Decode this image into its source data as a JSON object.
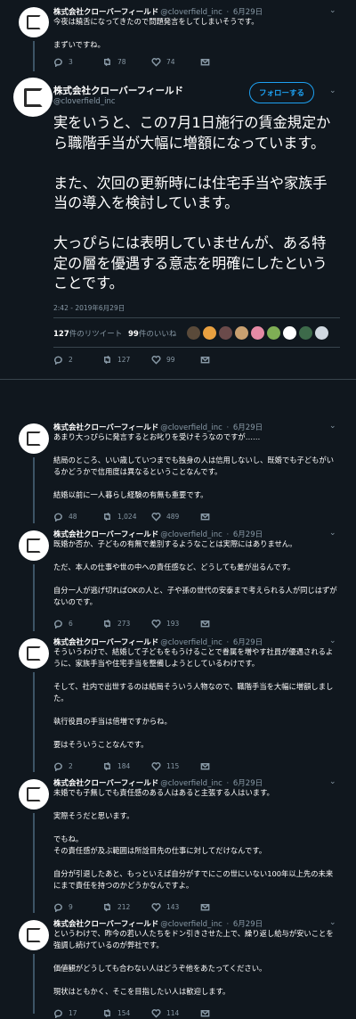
{
  "account": {
    "name": "株式会社クローバーフィールド",
    "handle": "@cloverfield_inc"
  },
  "tweet0": {
    "date": "6月29日",
    "lines": [
      "今夜は饒舌になってきたので問題発言をしてしまいそうです。",
      "まずいですね。"
    ],
    "replies": "3",
    "retweets": "78",
    "likes": "74"
  },
  "main": {
    "follow_label": "フォローする",
    "paragraphs": [
      "実をいうと、この7月1日施行の賃金規定から職階手当が大幅に増額になっています。",
      "また、次回の更新時には住宅手当や家族手当の導入を検討しています。",
      "大っぴらには表明していませんが、ある特定の層を優遇する意志を明確にしたということです。"
    ],
    "timestamp": "2:42 - 2019年6月29日",
    "retweet_count": "127",
    "retweet_label": "件のリツイート",
    "like_count": "99",
    "like_label": "件のいいね",
    "liker_colors": [
      "#5a4a3a",
      "#e8a040",
      "#6a4a4a",
      "#c9a070",
      "#e58aa5",
      "#7fae55",
      "#ffffff",
      "#3d6a4a",
      "#d0d8e0"
    ],
    "replies": "2",
    "retweets": "127",
    "likes": "99"
  },
  "tweets": [
    {
      "date": "6月29日",
      "lines": [
        "あまり大っぴらに発言するとお叱りを受けそうなのですが……",
        "結局のところ、いい歳していつまでも独身の人は信用しないし、既婚でも子どもがいるかどうかで信用度は異なるということなんです。",
        "結婚以前に一人暮らし経験の有無も重要です。"
      ],
      "replies": "48",
      "retweets": "1,024",
      "likes": "489"
    },
    {
      "date": "6月29日",
      "lines": [
        "既婚か否か、子どもの有無で差別するようなことは実際にはありません。",
        "ただ、本人の仕事や世の中への責任感など、どうしても差が出るんです。",
        "自分一人が逃げ切ればOKの人と、子や孫の世代の安泰まで考えられる人が同じはずがないのです。"
      ],
      "replies": "6",
      "retweets": "273",
      "likes": "193"
    },
    {
      "date": "6月29日",
      "lines": [
        "そういうわけで、結婚して子どもをもうけることで眷属を増やす社員が優遇されるように、家族手当や住宅手当を整備しようとしているわけです。",
        "そして、社内で出世するのは結局そういう人物なので、職階手当を大幅に増額しました。",
        "執行役員の手当は倍増ですからね。",
        "要はそういうことなんです。"
      ],
      "replies": "2",
      "retweets": "184",
      "likes": "115"
    },
    {
      "date": "6月29日",
      "lines": [
        "未婚でも子無しでも責任感のある人はあると主張する人はいます。",
        "実際そうだと思います。",
        "でもね。\nその責任感が及ぶ範囲は所詮目先の仕事に対してだけなんです。",
        "自分が引退したあと、もっといえば自分がすでにこの世にいない100年以上先の未来にまで責任を持つのかどうかなんですよ。"
      ],
      "replies": "9",
      "retweets": "212",
      "likes": "143"
    },
    {
      "date": "6月29日",
      "lines": [
        "というわけで、昨今の若い人たちをドン引きさせた上で、繰り返し給与が安いことを強調し続けているのが弊社です。",
        "価値観がどうしても合わない人はどうぞ他をあたってください。",
        "現状はともかく、そこを目指したい人は歓迎します。"
      ],
      "replies": "17",
      "retweets": "154",
      "likes": "114"
    }
  ]
}
